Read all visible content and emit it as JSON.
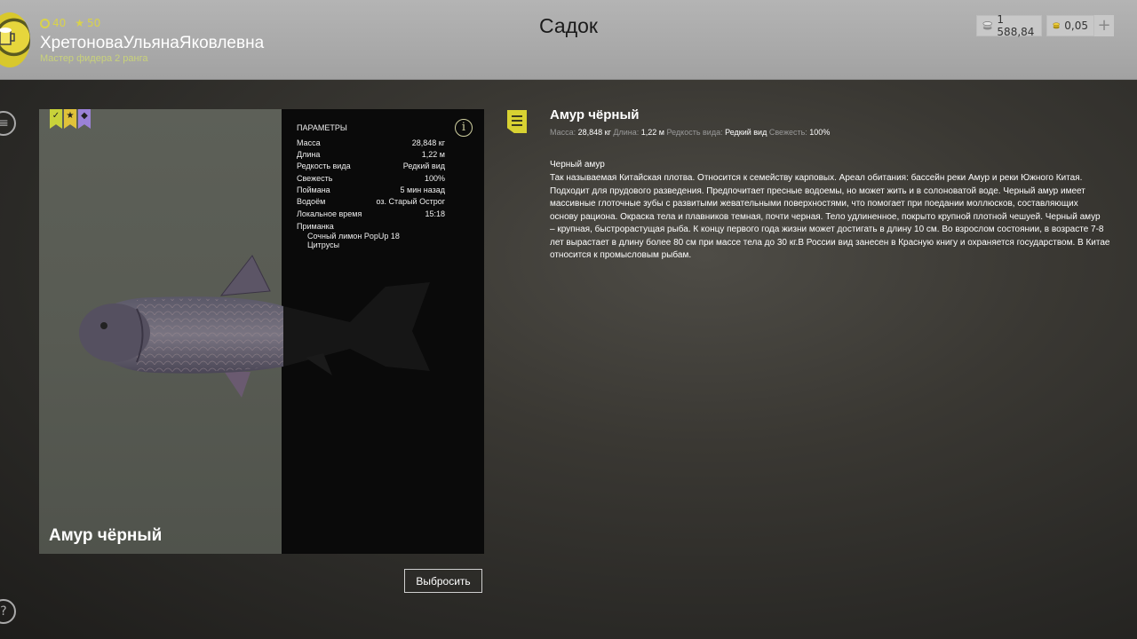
{
  "header": {
    "title": "Садок",
    "stats": {
      "level": "40",
      "stars": "50"
    },
    "username": "ХретоноваУльянаЯковлевна",
    "rank": "Мастер фидера 2 ранга",
    "silver": "1 588,84",
    "gold": "0,05",
    "plus_label": "+"
  },
  "fish_card": {
    "name": "Амур чёрный",
    "params_title": "ПАРАМЕТРЫ",
    "params": [
      {
        "label": "Масса",
        "value": "28,848 кг"
      },
      {
        "label": "Длина",
        "value": "1,22 м"
      },
      {
        "label": "Редкость вида",
        "value": "Редкий вид"
      },
      {
        "label": "Свежесть",
        "value": "100%"
      },
      {
        "label": "Поймана",
        "value": "5 мин назад"
      },
      {
        "label": "Водоём",
        "value": "оз. Старый Острог"
      },
      {
        "label": "Локальное время",
        "value": "15:18"
      }
    ],
    "bait_label": "Приманка",
    "bait_lines": [
      "Сочный лимон PopUp 18",
      "Цитрусы"
    ],
    "ribbon_colors": [
      "#c8d23a",
      "#e0c23a",
      "#9b82d8"
    ]
  },
  "actions": {
    "discard_label": "Выбросить"
  },
  "description": {
    "title": "Амур чёрный",
    "stats": {
      "mass_label": "Масса:",
      "mass": "28,848 кг",
      "length_label": "Длина:",
      "length": "1,22 м",
      "rarity_label": "Редкость вида:",
      "rarity": "Редкий вид",
      "freshness_label": "Свежесть:",
      "freshness": "100%"
    },
    "subtitle": "Черный амур",
    "lines": [
      "Так называемая Китайская плотва. Относится к семейству карповых. Ареал обитания: бассейн реки Амур и реки Южного Китая.",
      "Подходит для прудового разведения. Предпочитает пресные водоемы, но может жить и в солоноватой воде. Черный амур имеет",
      "массивные глоточные зубы с развитыми жевательными поверхностями, что помогает при поедании моллюсков, составляющих",
      "основу рациона. Окраска тела и плавников темная, почти черная. Тело удлиненное, покрыто крупной плотной чешуей. Черный амур",
      "– крупная, быстрорастущая рыба. К концу первого года жизни может достигать в длину 10 см. Во взрослом состоянии, в возрасте 7-8",
      "лет вырастает в длину более 80 см при массе тела до 30 кг.В России вид занесен в Красную книгу и охраняется государством. В Китае",
      "относится к промысловым рыбам."
    ]
  },
  "colors": {
    "accent": "#d8d232",
    "header_bg": "#b0b0b0",
    "panel_bg": "#0a0a0a"
  }
}
